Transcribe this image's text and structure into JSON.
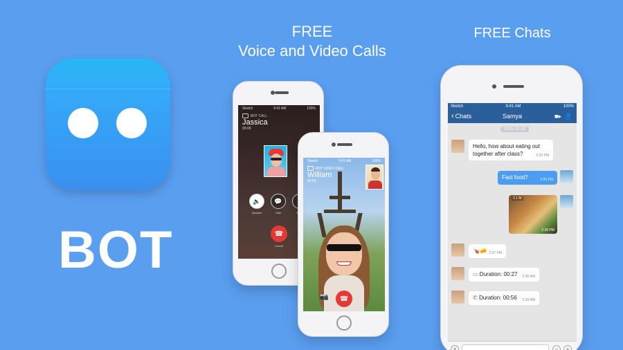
{
  "brand": {
    "name": "BOT"
  },
  "headers": {
    "calls_line1": "FREE",
    "calls_line2": "Voice and Video Calls",
    "chats": "FREE Chats"
  },
  "voice_call": {
    "carrier": "Sketch",
    "time": "9:41 AM",
    "battery": "100%",
    "badge": "BOT CALL",
    "caller": "Jassica",
    "duration": "00:00",
    "buttons": [
      {
        "label": "Speaker",
        "icon": "speaker-icon"
      },
      {
        "label": "Hide",
        "icon": "chat-bubble-icon"
      },
      {
        "label": "Mute",
        "icon": "mute-icon"
      }
    ],
    "cancel_label": "Cancel"
  },
  "video_call": {
    "carrier": "Sketch",
    "time": "9:41 AM",
    "battery": "100%",
    "badge": "BOT VIDEO CALL",
    "caller": "William",
    "duration": "00:06"
  },
  "chat": {
    "carrier": "Sketch",
    "time": "9:41 AM",
    "battery": "100%",
    "back_label": "Chats",
    "contact": "Samya",
    "date": "2015-12-18",
    "messages": [
      {
        "from": "them",
        "text": "Hello, how about eating out together after class?",
        "time": "2:33 PM"
      },
      {
        "from": "me",
        "text": "Fast food?",
        "time": "2:35 PM"
      },
      {
        "from": "me",
        "type": "image",
        "time": "2:36 PM",
        "image_tag": "0.1 M"
      },
      {
        "from": "them",
        "type": "sticker",
        "time": "2:37 PM"
      },
      {
        "from": "them",
        "text": "Duration: 00:27",
        "time": "2:36 AM",
        "icon": "video-icon"
      },
      {
        "from": "them",
        "text": "Duration: 00:56",
        "time": "2:36 AM",
        "icon": "phone-icon"
      }
    ]
  },
  "colors": {
    "background": "#5a9ef0",
    "logo": "#2fa9f6",
    "nav": "#2b5f9c",
    "bubble_me": "#4c9cf2",
    "end_call": "#e53935"
  }
}
